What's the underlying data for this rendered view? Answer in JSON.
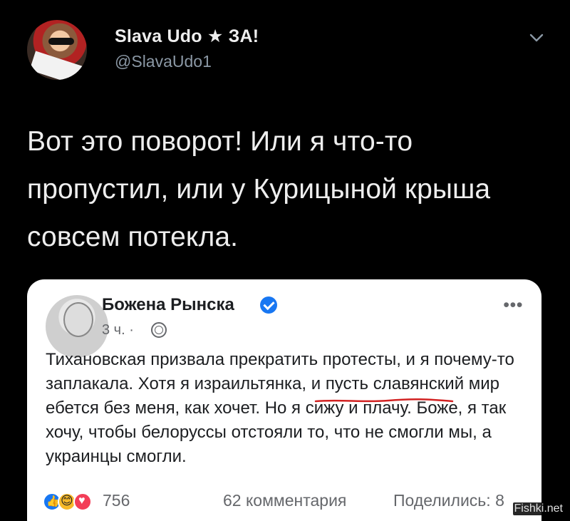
{
  "tweet": {
    "author": {
      "display_name": "Slava Udo ★ ЗА!",
      "handle": "@SlavaUdo1"
    },
    "text": "Вот это поворот! Или я что-то пропустил, или у Курицыной крыша совсем потекла."
  },
  "facebook_post": {
    "author_name": "Божена Рынска",
    "meta": "3 ч. ·",
    "text": "Тихановская призвала прекратить протесты, и я почему-то заплакала. Хотя я израильтянка, и пусть славянский мир ебется без меня, как хочет. Но я сижу и плачу. Боже, я так хочу, чтобы белоруссы отстояли то, что не смогли мы, а украинцы смогли.",
    "reactions_count": "756",
    "comments": "62 комментария",
    "shares": "Поделились: 8"
  },
  "watermark": "Fishki.net",
  "colors": {
    "background": "#000000",
    "twitter_secondary": "#8b98a5",
    "facebook_blue": "#1877f2",
    "facebook_secondary": "#65676b"
  },
  "icons": {
    "chevron": "chevron-down-icon",
    "verified": "verified-badge-icon",
    "globe": "globe-icon",
    "more": "more-options-icon"
  }
}
